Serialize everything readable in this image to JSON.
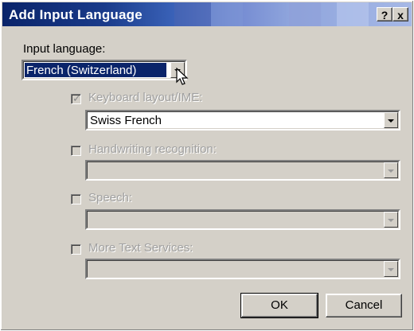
{
  "window": {
    "title": "Add Input Language",
    "help_button": "?",
    "close_button": "x"
  },
  "input_language": {
    "label": "Input language:",
    "value": "French (Switzerland)"
  },
  "keyboard": {
    "label": "Keyboard layout/IME:",
    "checked": true,
    "value": "Swiss French"
  },
  "handwriting": {
    "label": "Handwriting recognition:",
    "checked": false,
    "value": ""
  },
  "speech": {
    "label": "Speech:",
    "checked": false,
    "value": ""
  },
  "text_services": {
    "label": "More Text Services:",
    "checked": false,
    "value": ""
  },
  "buttons": {
    "ok": "OK",
    "cancel": "Cancel"
  },
  "colors": {
    "title_bar": "#0a246a",
    "face": "#d4d0c8",
    "selection": "#0a246a"
  }
}
